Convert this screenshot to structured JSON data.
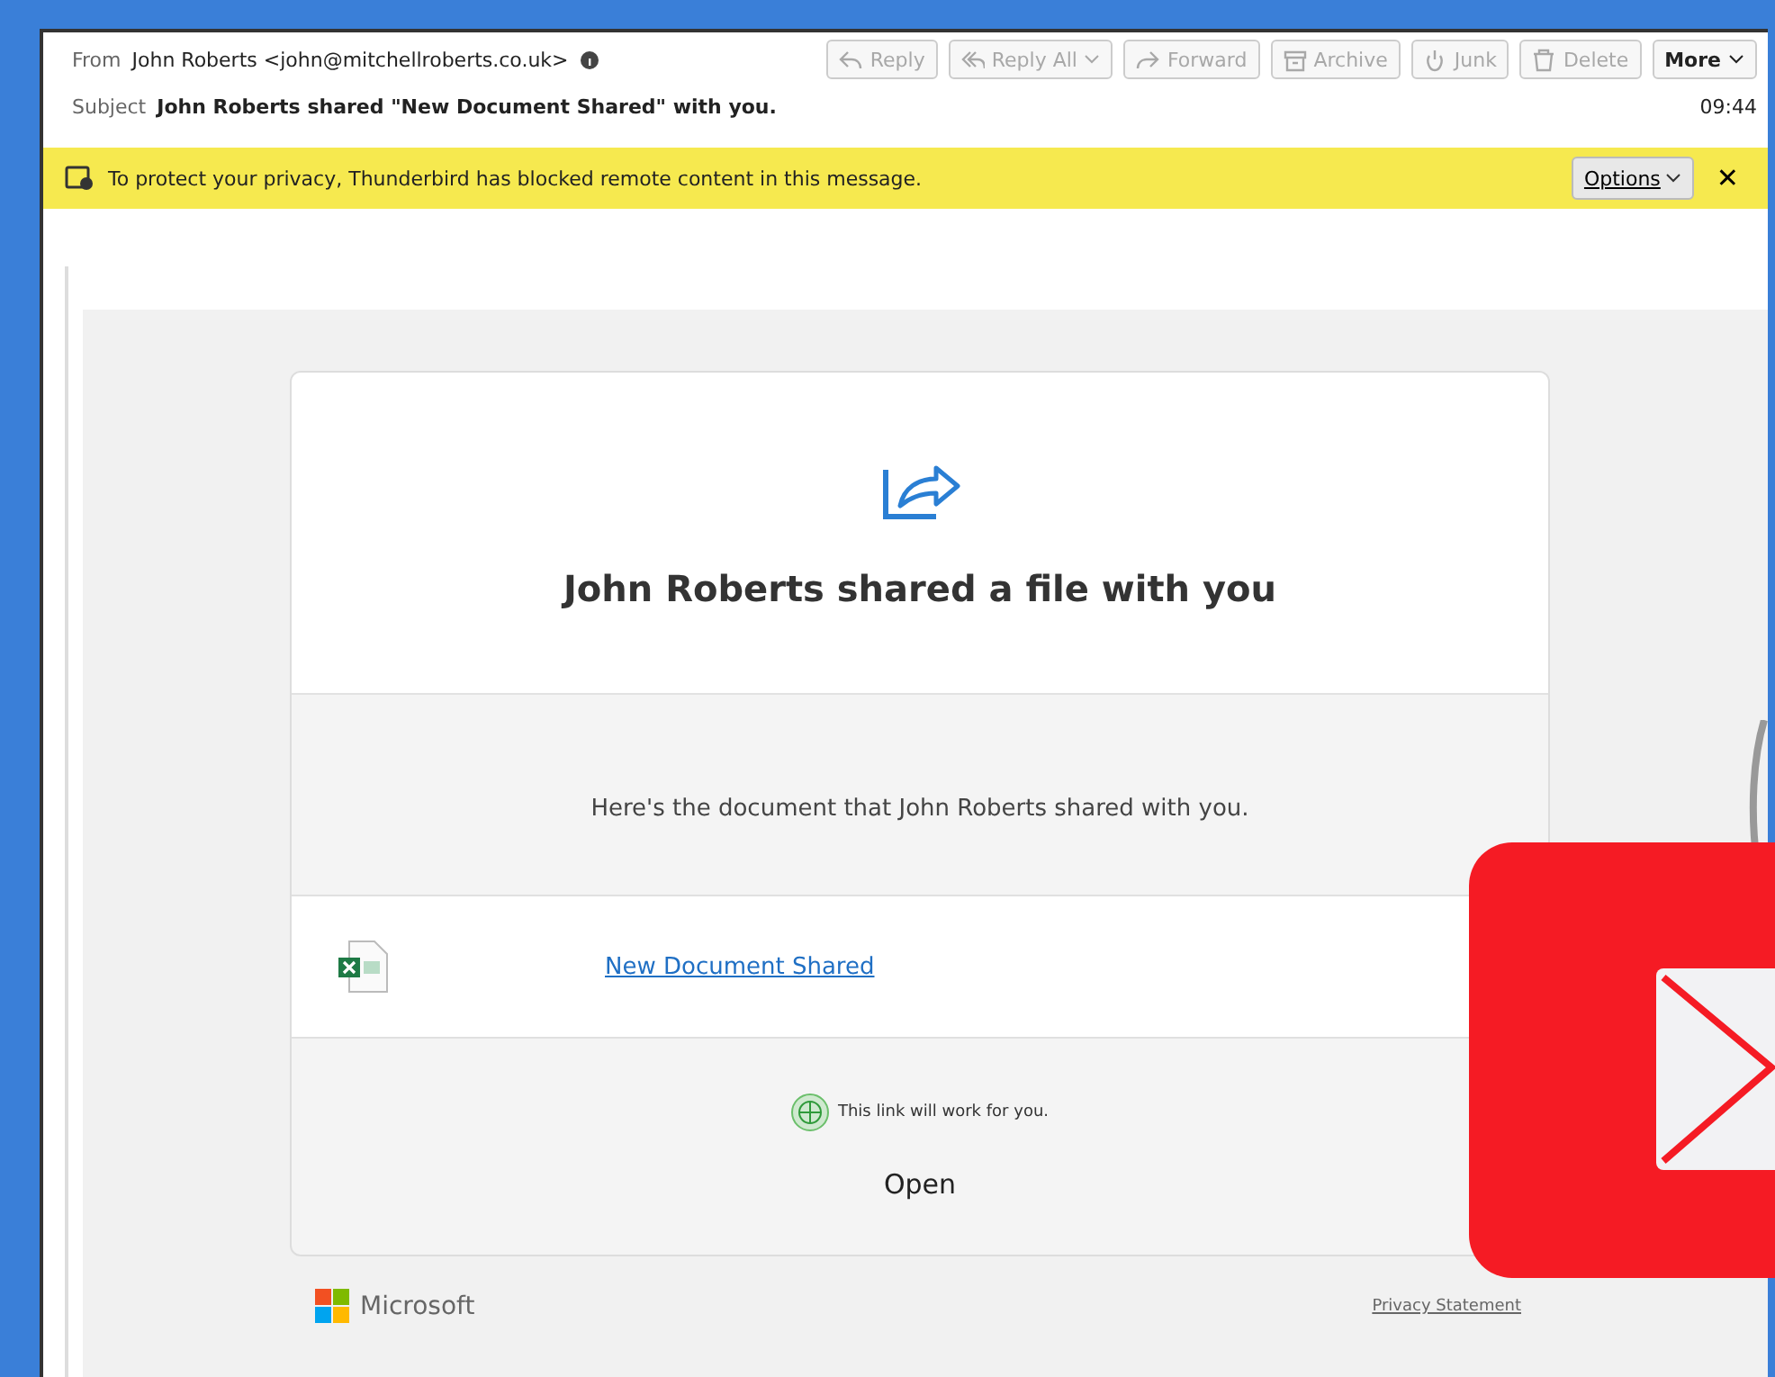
{
  "header": {
    "from_label": "From",
    "from_value": "John Roberts <john@mitchellroberts.co.uk>",
    "subject_label": "Subject",
    "subject_value": "John Roberts shared \"New Document Shared\" with you.",
    "time": "09:44",
    "buttons": [
      {
        "label": "Reply",
        "kind": "reply",
        "disabled": true
      },
      {
        "label": "Reply All",
        "kind": "replyall",
        "disabled": true
      },
      {
        "label": "Forward",
        "kind": "forward",
        "disabled": true
      },
      {
        "label": "Archive",
        "kind": "archive",
        "disabled": true
      },
      {
        "label": "Junk",
        "kind": "junk",
        "disabled": true
      },
      {
        "label": "Delete",
        "kind": "delete",
        "disabled": true
      },
      {
        "label": "More",
        "kind": "more",
        "disabled": false
      }
    ]
  },
  "notice": {
    "text": "To protect your privacy, Thunderbird has blocked remote content in this message.",
    "options": "Options",
    "close": "✕"
  },
  "message": {
    "title": "John Roberts shared a file with you",
    "intro": "Here's the document that John Roberts shared with you.",
    "file_link": "New Document Shared",
    "note": "This link will work for you.",
    "open": "Open",
    "brand": "Microsoft",
    "privacy": "Privacy Statement"
  }
}
